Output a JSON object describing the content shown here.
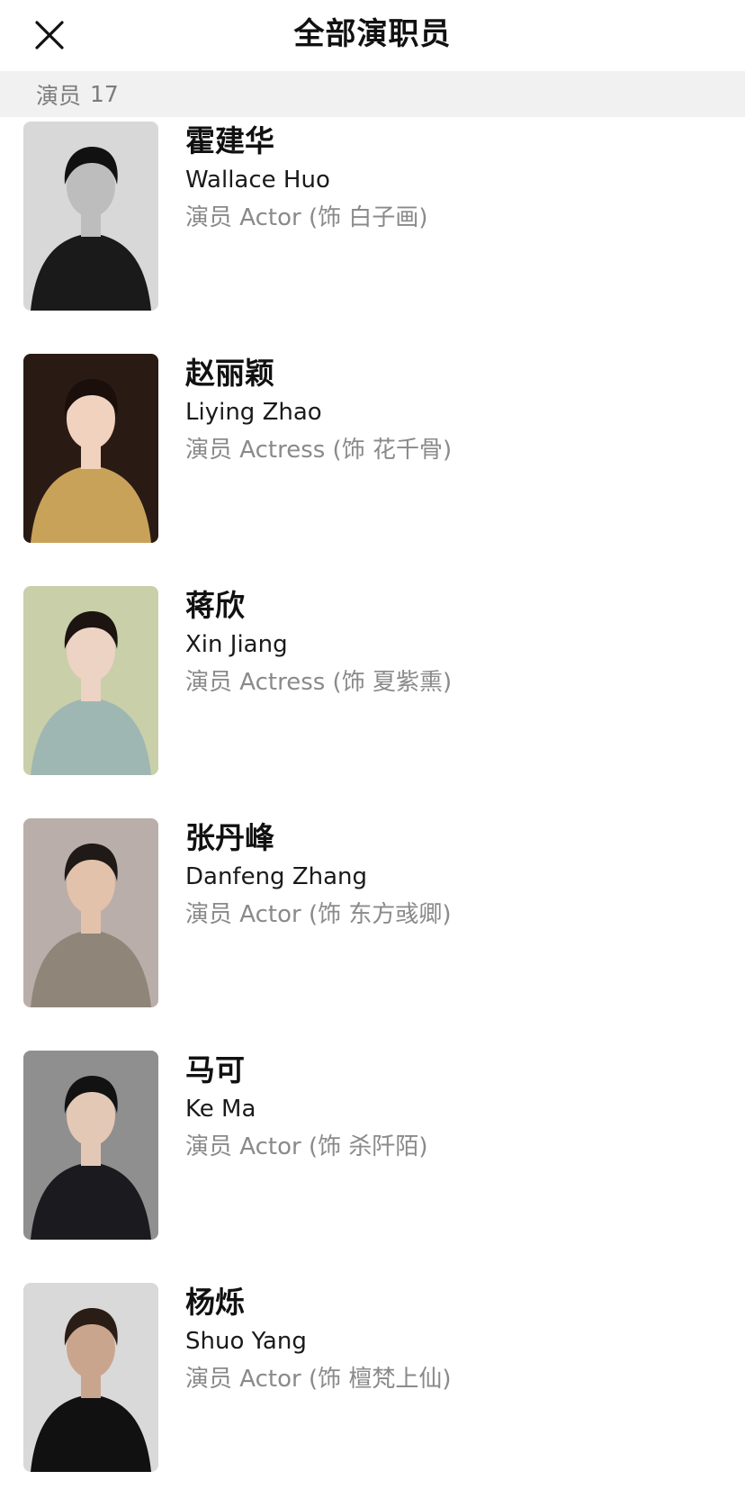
{
  "header": {
    "title": "全部演职员",
    "close_icon": "close-icon"
  },
  "section": {
    "label": "演员",
    "count": "17"
  },
  "cast": [
    {
      "name_cn": "霍建华",
      "name_en": "Wallace Huo",
      "role": "演员 Actor (饰 白子画)",
      "photo": {
        "bg": "#d8d8d8",
        "suit": "#1a1a1a",
        "skin": "#bdbdbd",
        "hair": "#111111",
        "grayscale": true
      }
    },
    {
      "name_cn": "赵丽颖",
      "name_en": "Liying Zhao",
      "role": "演员 Actress (饰 花千骨)",
      "photo": {
        "bg": "#2a1a14",
        "suit": "#c9a25a",
        "skin": "#f0d2bf",
        "hair": "#1a0f0b"
      }
    },
    {
      "name_cn": "蒋欣",
      "name_en": "Xin Jiang",
      "role": "演员 Actress (饰 夏紫熏)",
      "photo": {
        "bg": "#c9cfa9",
        "suit": "#9fb7b3",
        "skin": "#ecd3c4",
        "hair": "#1c1410"
      }
    },
    {
      "name_cn": "张丹峰",
      "name_en": "Danfeng Zhang",
      "role": "演员 Actor (饰 东方彧卿)",
      "photo": {
        "bg": "#b9aeaa",
        "suit": "#8f8579",
        "skin": "#e2c2ab",
        "hair": "#1f1a17"
      }
    },
    {
      "name_cn": "马可",
      "name_en": "Ke Ma",
      "role": "演员 Actor (饰 杀阡陌)",
      "photo": {
        "bg": "#8f8f8f",
        "suit": "#1b1b1f",
        "skin": "#e4c8b6",
        "hair": "#121212"
      }
    },
    {
      "name_cn": "杨烁",
      "name_en": "Shuo Yang",
      "role": "演员 Actor (饰 檀梵上仙)",
      "photo": {
        "bg": "#d9d9d9",
        "suit": "#111111",
        "skin": "#caa58e",
        "hair": "#2a1d16"
      }
    }
  ]
}
